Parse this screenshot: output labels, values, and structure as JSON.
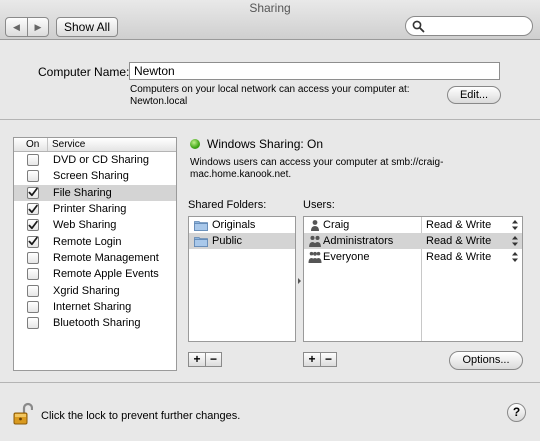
{
  "window": {
    "title": "Sharing"
  },
  "toolbar": {
    "show_all_label": "Show All",
    "back_icon": "back-arrow-icon",
    "forward_icon": "forward-arrow-icon"
  },
  "search": {
    "placeholder": ""
  },
  "computer_name": {
    "label": "Computer Name:",
    "value": "Newton",
    "info_line1": "Computers on your local network can access your computer at:",
    "info_line2": "Newton.local",
    "edit_label": "Edit..."
  },
  "services": {
    "header_on": "On",
    "header_service": "Service",
    "items": [
      {
        "label": "DVD or CD Sharing",
        "checked": false,
        "selected": false
      },
      {
        "label": "Screen Sharing",
        "checked": false,
        "selected": false
      },
      {
        "label": "File Sharing",
        "checked": true,
        "selected": true
      },
      {
        "label": "Printer Sharing",
        "checked": true,
        "selected": false
      },
      {
        "label": "Web Sharing",
        "checked": true,
        "selected": false
      },
      {
        "label": "Remote Login",
        "checked": true,
        "selected": false
      },
      {
        "label": "Remote Management",
        "checked": false,
        "selected": false
      },
      {
        "label": "Remote Apple Events",
        "checked": false,
        "selected": false
      },
      {
        "label": "Xgrid Sharing",
        "checked": false,
        "selected": false
      },
      {
        "label": "Internet Sharing",
        "checked": false,
        "selected": false
      },
      {
        "label": "Bluetooth Sharing",
        "checked": false,
        "selected": false
      }
    ]
  },
  "status": {
    "text": "Windows Sharing: On",
    "color": "#3fa516",
    "info_line1": "Windows users can access your computer at smb://craig-",
    "info_line2": "mac.home.kanook.net."
  },
  "shared_folders": {
    "label": "Shared Folders:",
    "items": [
      {
        "name": "Originals",
        "selected": false
      },
      {
        "name": "Public",
        "selected": true
      }
    ],
    "add_label": "+",
    "remove_label": "−"
  },
  "users": {
    "label": "Users:",
    "items": [
      {
        "name": "Craig",
        "permission": "Read & Write",
        "icon": "single-user-icon",
        "selected": false
      },
      {
        "name": "Administrators",
        "permission": "Read & Write",
        "icon": "group-icon",
        "selected": true
      },
      {
        "name": "Everyone",
        "permission": "Read & Write",
        "icon": "everyone-icon",
        "selected": false
      }
    ],
    "add_label": "+",
    "remove_label": "−"
  },
  "options_label": "Options...",
  "lock": {
    "text": "Click the lock to prevent further changes."
  },
  "help_label": "?"
}
